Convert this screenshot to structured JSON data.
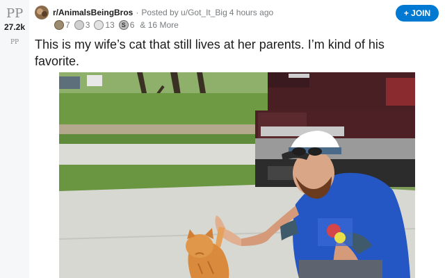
{
  "vote": {
    "up_glyph": "PP",
    "score": "27.2k",
    "down_glyph": "PP"
  },
  "meta": {
    "subreddit": "r/AnimalsBeingBros",
    "separator": "·",
    "posted_by": "Posted by u/Got_It_Big",
    "time_ago": "4 hours ago"
  },
  "awards": {
    "items": [
      {
        "icon": "award-icon",
        "count": "7"
      },
      {
        "icon": "award-icon",
        "count": "3"
      },
      {
        "icon": "award-icon",
        "count": "13"
      },
      {
        "icon": "award-icon",
        "count": "6"
      }
    ],
    "more": "& 16 More"
  },
  "join_button": {
    "label": "+ JOIN",
    "color": "#0079d3"
  },
  "post": {
    "title": "This is my wife’s cat that still lives at her parents. I’m kind of his favorite."
  },
  "media": {
    "alt": "A man in a cap crouches on a driveway giving a high five to an orange cat, a pickup truck behind him."
  },
  "colors": {
    "vote_rail": "#f6f7f8",
    "meta_text": "#787c7e",
    "title_text": "#1c1c1c"
  }
}
